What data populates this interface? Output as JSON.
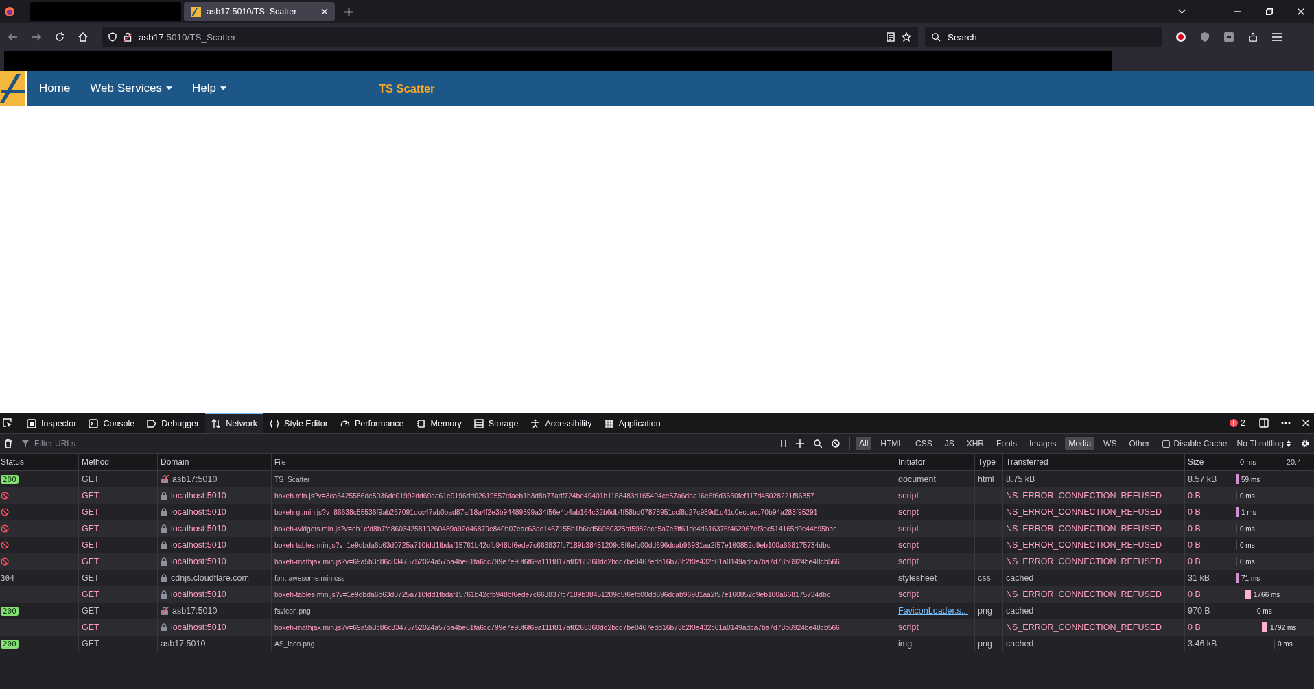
{
  "browser": {
    "tabs": [
      {
        "title": "asb17:5010/TS_Scatter",
        "selected": true
      }
    ],
    "address": {
      "host": "asb17",
      "path": ":5010/TS_Scatter"
    },
    "search": {
      "placeholder": "Search"
    }
  },
  "navbar": {
    "items": [
      {
        "label": "Home",
        "dropdown": false
      },
      {
        "label": "Web Services",
        "dropdown": true
      },
      {
        "label": "Help",
        "dropdown": true
      }
    ],
    "title": "TS Scatter"
  },
  "devtools": {
    "tabs": [
      {
        "label": "Inspector",
        "kind": "inspector",
        "selected": false
      },
      {
        "label": "Console",
        "kind": "console",
        "selected": false
      },
      {
        "label": "Debugger",
        "kind": "debugger",
        "selected": false
      },
      {
        "label": "Network",
        "kind": "network",
        "selected": true
      },
      {
        "label": "Style Editor",
        "kind": "style",
        "selected": false
      },
      {
        "label": "Performance",
        "kind": "performance",
        "selected": false
      },
      {
        "label": "Memory",
        "kind": "memory",
        "selected": false
      },
      {
        "label": "Storage",
        "kind": "storage",
        "selected": false
      },
      {
        "label": "Accessibility",
        "kind": "accessibility",
        "selected": false
      },
      {
        "label": "Application",
        "kind": "application",
        "selected": false
      }
    ],
    "error_count": "2",
    "filter": {
      "placeholder": "Filter URLs"
    },
    "type_filters": [
      {
        "label": "All",
        "selected": true
      },
      {
        "label": "HTML",
        "selected": false
      },
      {
        "label": "CSS",
        "selected": false
      },
      {
        "label": "JS",
        "selected": false
      },
      {
        "label": "XHR",
        "selected": false
      },
      {
        "label": "Fonts",
        "selected": false
      },
      {
        "label": "Images",
        "selected": false
      },
      {
        "label": "Media",
        "selected": true
      },
      {
        "label": "WS",
        "selected": false
      },
      {
        "label": "Other",
        "selected": false
      }
    ],
    "disable_cache": {
      "label": "Disable Cache",
      "checked": false
    },
    "throttling": "No Throttling",
    "columns": [
      "Status",
      "Method",
      "Domain",
      "File",
      "Initiator",
      "Type",
      "Transferred",
      "Size"
    ],
    "waterfall_ticks": [
      "0 ms",
      "20.4"
    ],
    "rows": [
      {
        "kind": "ok",
        "status": "200",
        "error": false,
        "method": "GET",
        "secure": false,
        "domain": "asb17:5010",
        "file": "TS_Scatter",
        "initiator": "document",
        "initiator_link": false,
        "type": "html",
        "transferred": "8.75 kB",
        "size": "8.57 kB",
        "timing": "59 ms"
      },
      {
        "kind": "blocked",
        "error": true,
        "method": "GET",
        "secure": true,
        "domain": "localhost:5010",
        "file": "bokeh.min.js?v=3ca6425586de5036dc01992dd69aa61e9196dd02619557cfaeb1b3d8b77adf724be49401b1168483d165494ce57a6daa16e6f6d3660fef117d45028221f86357",
        "initiator": "script",
        "initiator_link": false,
        "transferred": "NS_ERROR_CONNECTION_REFUSED",
        "size": "0 B",
        "timing": "0 ms"
      },
      {
        "kind": "blocked",
        "error": true,
        "method": "GET",
        "secure": true,
        "domain": "localhost:5010",
        "file": "bokeh-gl.min.js?v=86638c55536f9ab267091dcc47ab0bad87af18a4f2e3b94489599a34f56e4b4ab164c32b6db4f58bd07878951ccf8d27c989d1c41c0eccacc70b94a283f95291",
        "initiator": "script",
        "initiator_link": false,
        "transferred": "NS_ERROR_CONNECTION_REFUSED",
        "size": "0 B",
        "timing": "1 ms"
      },
      {
        "kind": "blocked",
        "error": true,
        "method": "GET",
        "secure": true,
        "domain": "localhost:5010",
        "file": "bokeh-widgets.min.js?v=eb1cfd8b7fe8603425819260489a92d46879e840b07eac63ac1467155b1b6cd56960325af5982ccc5a7e6ff61dc4d616376f462967ef3ec514165d0c44b95bec",
        "initiator": "script",
        "initiator_link": false,
        "transferred": "NS_ERROR_CONNECTION_REFUSED",
        "size": "0 B",
        "timing": "0 ms"
      },
      {
        "kind": "blocked",
        "error": true,
        "method": "GET",
        "secure": true,
        "domain": "localhost:5010",
        "file": "bokeh-tables.min.js?v=1e9dbda6b63d0725a710fdd1fbdaf15761b42cfb948bf6ede7c663837fc7189b38451209d5f6efb00dd696dcab96981aa2f57e160852d9eb100a668175734dbc",
        "initiator": "script",
        "initiator_link": false,
        "transferred": "NS_ERROR_CONNECTION_REFUSED",
        "size": "0 B",
        "timing": "0 ms"
      },
      {
        "kind": "blocked",
        "error": true,
        "method": "GET",
        "secure": true,
        "domain": "localhost:5010",
        "file": "bokeh-mathjax.min.js?v=69a5b3c86c83475752024a57ba4be61fa6cc799e7e90f6f69a111f817af8265360dd2bcd7be0467edd16b73b2f0e432c61a0149adca7ba7d78b6924be48cb566",
        "initiator": "script",
        "initiator_link": false,
        "transferred": "NS_ERROR_CONNECTION_REFUSED",
        "size": "0 B",
        "timing": "0 ms"
      },
      {
        "kind": "code",
        "status": "304",
        "error": false,
        "method": "GET",
        "secure": true,
        "domain": "cdnjs.cloudflare.com",
        "file": "font-awesome.min.css",
        "initiator": "stylesheet",
        "initiator_link": false,
        "type": "css",
        "transferred": "cached",
        "size": "31 kB",
        "timing": "71 ms"
      },
      {
        "kind": "none",
        "error": true,
        "method": "GET",
        "secure": true,
        "domain": "localhost:5010",
        "file": "bokeh-tables.min.js?v=1e9dbda6b63d0725a710fdd1fbdaf15761b42cfb948bf6ede7c663837fc7189b38451209d5f6efb00dd696dcab96981aa2f57e160852d9eb100a668175734dbc",
        "initiator": "script",
        "initiator_link": false,
        "transferred": "NS_ERROR_CONNECTION_REFUSED",
        "size": "0 B",
        "timing": "1766 ms"
      },
      {
        "kind": "ok",
        "status": "200",
        "error": false,
        "method": "GET",
        "secure": false,
        "domain": "asb17:5010",
        "file": "favicon.png",
        "initiator": "FaviconLoader.s...",
        "initiator_link": true,
        "type": "png",
        "transferred": "cached",
        "size": "970 B",
        "timing": "0 ms"
      },
      {
        "kind": "none",
        "error": true,
        "method": "GET",
        "secure": true,
        "domain": "localhost:5010",
        "file": "bokeh-mathjax.min.js?v=69a5b3c86c83475752024a57ba4be61fa6cc799e7e90f6f69a111f817af8265360dd2bcd7be0467edd16b73b2f0e432c61a0149adca7ba7d78b6924be48cb566",
        "initiator": "script",
        "initiator_link": false,
        "transferred": "NS_ERROR_CONNECTION_REFUSED",
        "size": "0 B",
        "timing": "1792 ms"
      },
      {
        "kind": "ok",
        "status": "200",
        "error": false,
        "method": "GET",
        "domain": "asb17:5010",
        "file": "AS_icon.png",
        "initiator": "img",
        "initiator_link": false,
        "type": "png",
        "transferred": "cached",
        "size": "3.46 kB",
        "timing": "0 ms"
      }
    ]
  }
}
